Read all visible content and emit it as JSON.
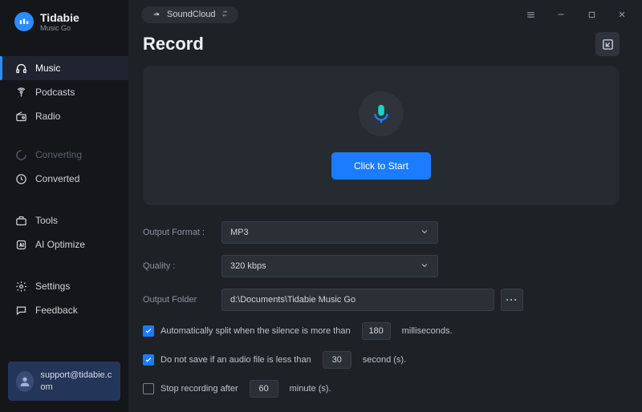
{
  "brand": {
    "name": "Tidabie",
    "sub": "Music Go"
  },
  "sidebar": {
    "items": [
      {
        "label": "Music",
        "icon": "headphones",
        "selected": true
      },
      {
        "label": "Podcasts",
        "icon": "broadcast",
        "selected": false
      },
      {
        "label": "Radio",
        "icon": "radio",
        "selected": false
      }
    ],
    "items2": [
      {
        "label": "Converting",
        "icon": "spinner",
        "inactive": true
      },
      {
        "label": "Converted",
        "icon": "clock",
        "inactive": false
      }
    ],
    "items3": [
      {
        "label": "Tools",
        "icon": "toolbox"
      },
      {
        "label": "AI Optimize",
        "icon": "ai"
      }
    ],
    "items4": [
      {
        "label": "Settings",
        "icon": "gear"
      },
      {
        "label": "Feedback",
        "icon": "chat"
      }
    ]
  },
  "support_email": "support@tidabie.com",
  "titlebar": {
    "source": "SoundCloud"
  },
  "page": {
    "title": "Record",
    "start_label": "Click to Start"
  },
  "form": {
    "output_format_label": "Output Format :",
    "output_format_value": "MP3",
    "quality_label": "Quality :",
    "quality_value": "320 kbps",
    "output_folder_label": "Output Folder",
    "output_folder_value": "d:\\Documents\\Tidabie Music Go",
    "auto_split": {
      "checked": true,
      "pre": "Automatically split when the silence is more than",
      "value": "180",
      "post": "milliseconds."
    },
    "min_len": {
      "checked": true,
      "pre": "Do not save if an audio file is less than",
      "value": "30",
      "post": "second (s)."
    },
    "stop_after": {
      "checked": false,
      "pre": "Stop recording after",
      "value": "60",
      "post": "minute (s)."
    }
  }
}
